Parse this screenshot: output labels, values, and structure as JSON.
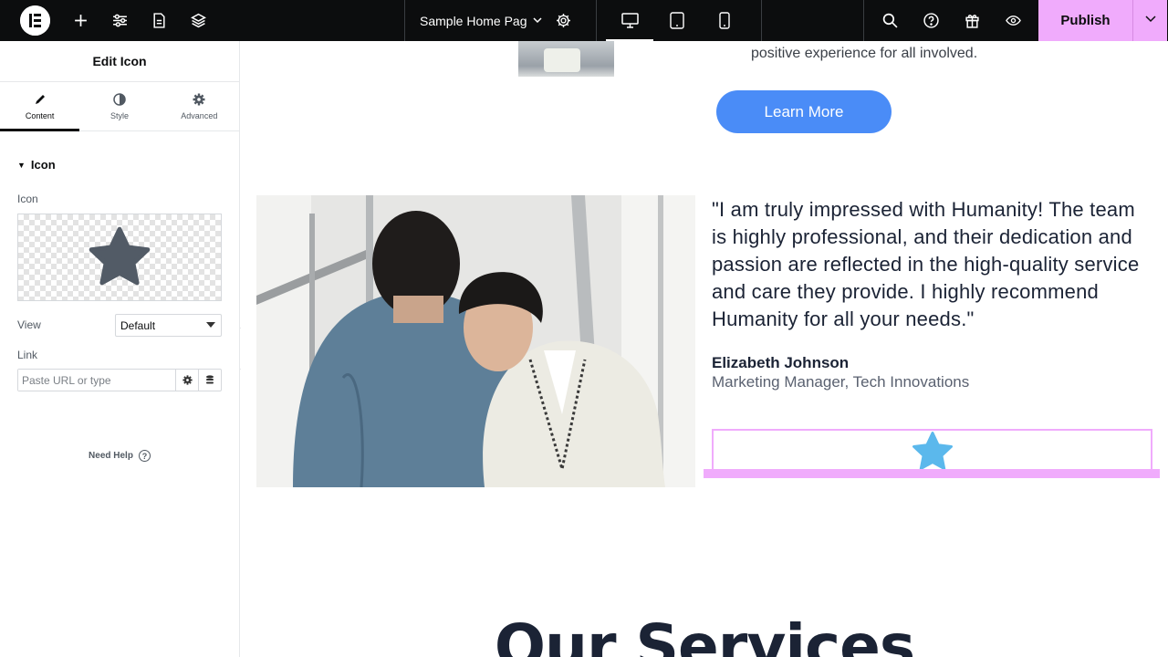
{
  "topbar": {
    "document_title": "Sample Home Page",
    "publish_label": "Publish",
    "icons": [
      "elementor-logo-icon",
      "plus-icon",
      "sliders-icon",
      "page-icon",
      "layers-icon",
      "settings-icon",
      "desktop-icon",
      "tablet-icon",
      "mobile-icon",
      "search-icon",
      "help-icon",
      "gift-icon",
      "eye-icon",
      "chevron-down-icon"
    ],
    "accent": "#f0abfc"
  },
  "panel": {
    "title": "Edit Icon",
    "tabs": [
      {
        "label": "Content",
        "icon": "pencil-icon",
        "active": true
      },
      {
        "label": "Style",
        "icon": "half-circle-icon",
        "active": false
      },
      {
        "label": "Advanced",
        "icon": "gear-icon",
        "active": false
      }
    ],
    "section_title": "Icon",
    "icon_label": "Icon",
    "view_label": "View",
    "view_value": "Default",
    "link_label": "Link",
    "link_placeholder": "Paste URL or type",
    "need_help": "Need Help"
  },
  "canvas": {
    "top_text": "positive experience for all involved.",
    "learn_more": "Learn More",
    "quote": "\"I am truly impressed with Humanity! The team is highly professional, and their dedication and passion are reflected in the high-quality service and care they provide. I highly recommend Humanity for all your needs.\"",
    "author_name": "Elizabeth Johnson",
    "author_role": "Marketing Manager, Tech Innovations",
    "services_heading": "Our Services",
    "button_color": "#4a8cf7",
    "star_color": "#5bb8ec"
  }
}
